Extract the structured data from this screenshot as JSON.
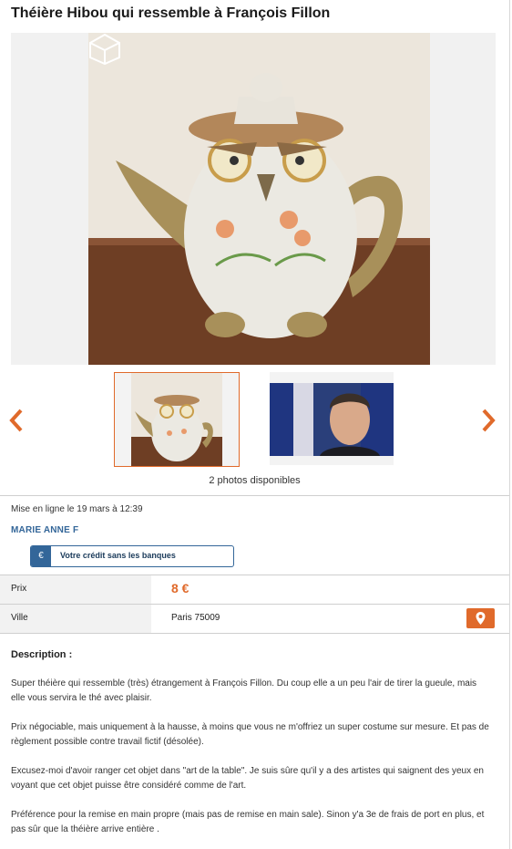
{
  "listing": {
    "title": "Théière Hibou qui ressemble à François Fillon",
    "photo_count": "2 photos disponibles",
    "posted": "Mise en ligne le 19 mars à 12:39",
    "seller": "MARIE ANNE F",
    "credit_button": "Votre crédit sans les banques",
    "price_label": "Prix",
    "price_value": "8 €",
    "city_label": "Ville",
    "city_value": "Paris 75009",
    "description_title": "Description :",
    "description": [
      "Super théière qui ressemble (très) étrangement à François Fillon. Du coup elle a un peu l'air de tirer la gueule, mais elle vous servira le thé avec plaisir.",
      "Prix négociable, mais uniquement à la hausse, à moins que vous ne m'offriez un super costume sur mesure. Et pas de règlement possible contre travail fictif (désolée).",
      "Excusez-moi d'avoir ranger cet objet dans \"art de la table\". Je suis sûre qu'il y a des artistes qui saignent des yeux en voyant que cet objet puisse être considéré comme de l'art.",
      "Préférence pour la remise en main propre (mais pas de remise en main sale). Sinon y'a 3e de frais de port en plus, et pas sûr que la théière arrive entière ."
    ]
  },
  "icons": {
    "prev": "chevron-left-icon",
    "next": "chevron-right-icon",
    "credit": "euro-icon",
    "map": "map-pin-icon"
  },
  "colors": {
    "accent": "#e06a2b",
    "blue": "#336699"
  }
}
